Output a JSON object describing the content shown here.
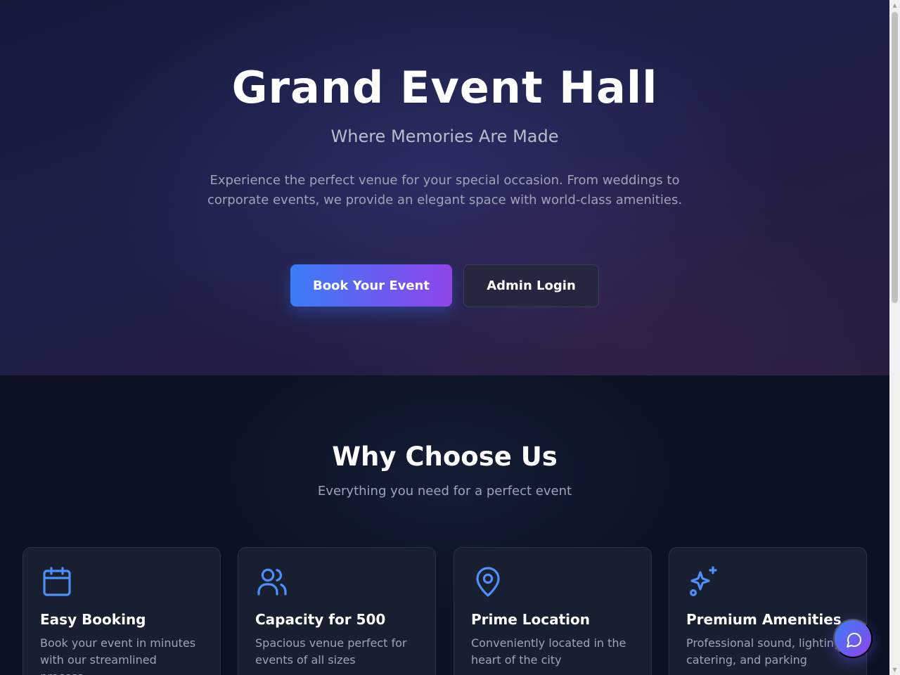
{
  "hero": {
    "title": "Grand Event Hall",
    "subtitle": "Where Memories Are Made",
    "description": "Experience the perfect venue for your special occasion. From weddings to corporate events, we provide an elegant space with world-class amenities.",
    "primary_button": "Book Your Event",
    "secondary_button": "Admin Login"
  },
  "features": {
    "title": "Why Choose Us",
    "subtitle": "Everything you need for a perfect event",
    "cards": [
      {
        "icon": "calendar-icon",
        "title": "Easy Booking",
        "description": "Book your event in minutes with our streamlined process"
      },
      {
        "icon": "users-icon",
        "title": "Capacity for 500",
        "description": "Spacious venue perfect for events of all sizes"
      },
      {
        "icon": "map-pin-icon",
        "title": "Prime Location",
        "description": "Conveniently located in the heart of the city"
      },
      {
        "icon": "sparkles-icon",
        "title": "Premium Amenities",
        "description": "Professional sound, lighting, catering, and parking"
      }
    ]
  },
  "chat": {
    "icon": "chat-bubble-icon"
  },
  "colors": {
    "accent_blue": "#3b7cf6",
    "accent_purple": "#8f45e8",
    "icon_blue": "#4f8ff7"
  }
}
